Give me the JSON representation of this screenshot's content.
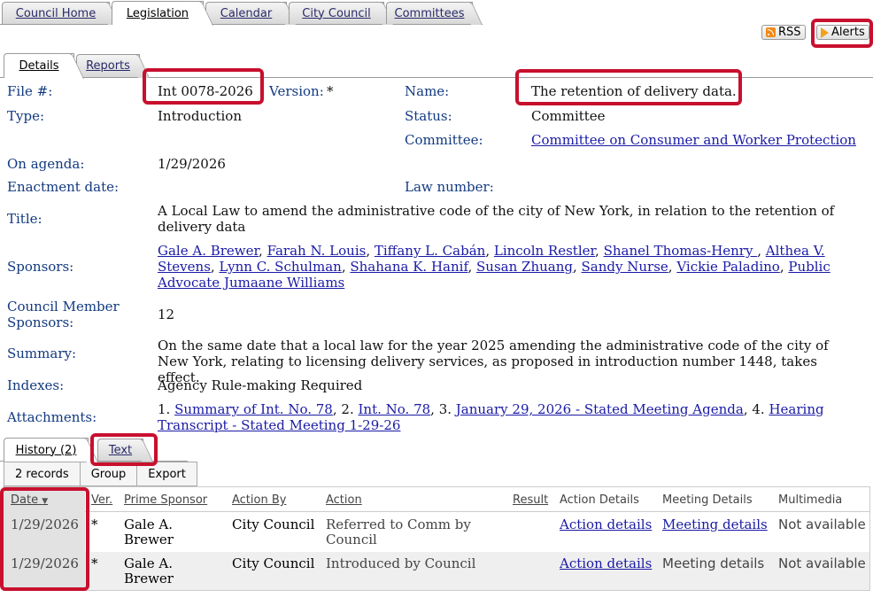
{
  "top_tabs": [
    "Council Home",
    "Legislation",
    "Calendar",
    "City Council",
    "Committees"
  ],
  "feeds": {
    "rss": "RSS",
    "alerts": "Alerts"
  },
  "detail_tabs": [
    "Details",
    "Reports"
  ],
  "fields": {
    "file_label": "File #:",
    "file_value": "Int 0078-2026",
    "version_label": "Version:",
    "version_value": "*",
    "name_label": "Name:",
    "name_value": "The retention of delivery data.",
    "type_label": "Type:",
    "type_value": "Introduction",
    "status_label": "Status:",
    "status_value": "Committee",
    "committee_label": "Committee:",
    "committee_value": "Committee on Consumer and Worker Protection",
    "agenda_label": "On agenda:",
    "agenda_value": "1/29/2026",
    "enactment_label": "Enactment date:",
    "law_label": "Law number:",
    "title_label": "Title:",
    "title_value": "A Local Law to amend the administrative code of the city of New York, in relation to the retention of delivery data",
    "sponsors_label": "Sponsors:",
    "cms_label_1": "Council Member",
    "cms_label_2": "Sponsors:",
    "cms_value": "12",
    "summary_label": "Summary:",
    "summary_value": "On the same date that a local law for the year 2025 amending the administrative code of the city of New York, relating to licensing delivery services, as proposed in introduction number 1448, takes effect.",
    "indexes_label": "Indexes:",
    "indexes_value": "Agency Rule-making Required",
    "attachments_label": "Attachments:"
  },
  "sponsors": [
    "Gale A. Brewer",
    "Farah N. Louis",
    "Tiffany L. Cabán",
    "Lincoln Restler",
    "Shanel Thomas-Henry ",
    "Althea V. Stevens",
    "Lynn C. Schulman",
    "Shahana K. Hanif",
    "Susan Zhuang",
    "Sandy Nurse",
    "Vickie Paladino",
    "Public Advocate Jumaane Williams"
  ],
  "attachments": [
    "Summary of Int. No. 78",
    "Int. No. 78",
    "January 29, 2026 - Stated Meeting Agenda",
    "Hearing Transcript - Stated Meeting 1-29-26"
  ],
  "history_tabs": [
    "History (2)",
    "Text"
  ],
  "history_buttons": [
    "2 records",
    "Group",
    "Export"
  ],
  "history_headers": [
    "Date",
    "Ver.",
    "Prime Sponsor",
    "Action By",
    "Action",
    "Result",
    "Action Details",
    "Meeting Details",
    "Multimedia"
  ],
  "history_rows": [
    {
      "date": "1/29/2026",
      "ver": "*",
      "sponsor": "Gale A. Brewer",
      "action_by": "City Council",
      "action": "Referred to Comm by Council",
      "result": "",
      "action_details": "Action details",
      "meeting_details": "Meeting details",
      "multimedia": "Not available"
    },
    {
      "date": "1/29/2026",
      "ver": "*",
      "sponsor": "Gale A. Brewer",
      "action_by": "City Council",
      "action": "Introduced by Council",
      "result": "",
      "action_details": "Action details",
      "meeting_details": "Meeting details",
      "multimedia": "Not available"
    }
  ]
}
